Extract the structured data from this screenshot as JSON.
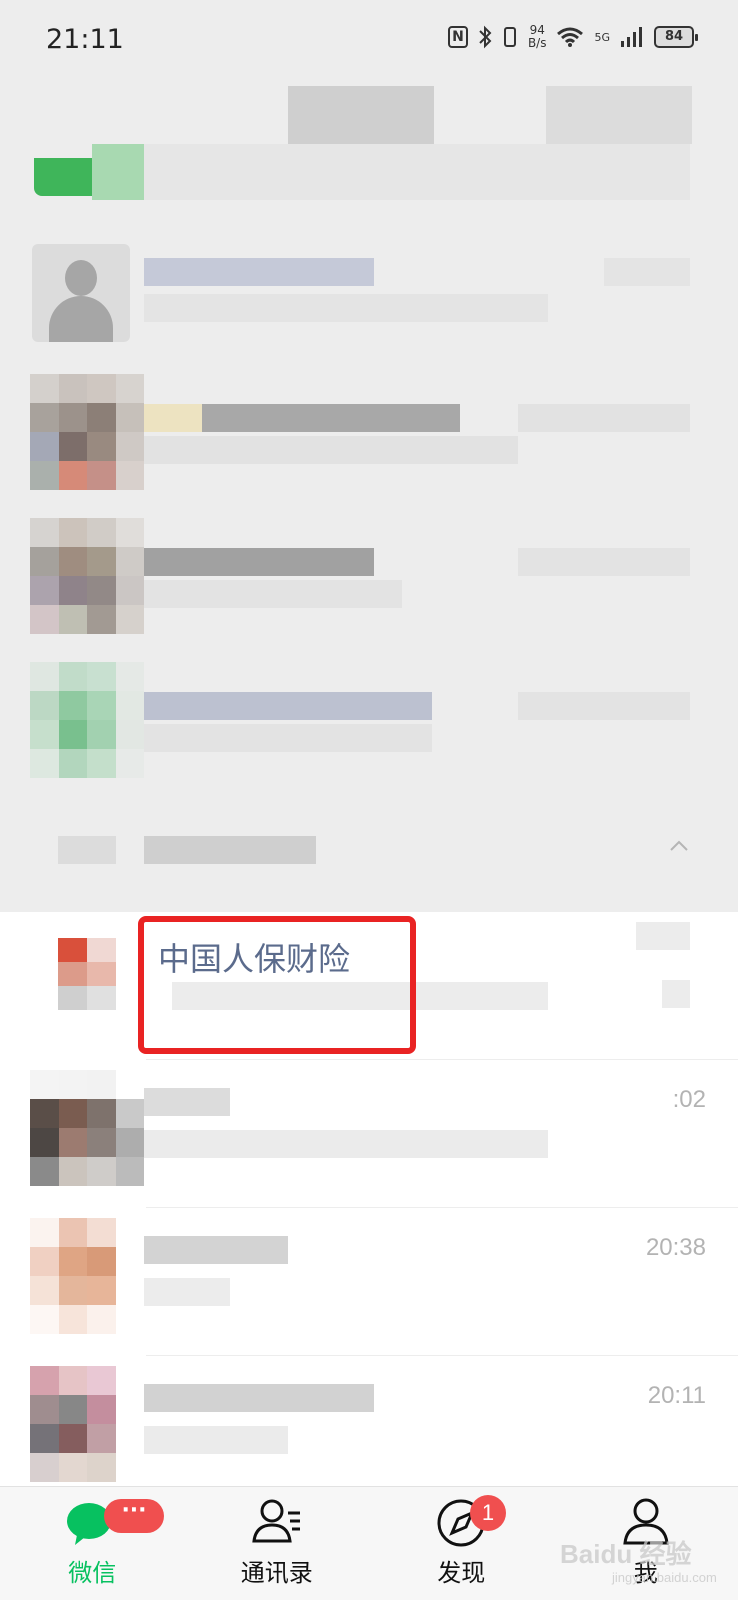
{
  "status_bar": {
    "time": "21:11",
    "net_speed_value": "94",
    "net_speed_unit": "B/s",
    "signal_label": "5G",
    "battery": "84"
  },
  "chats": [
    {
      "name": "中国人保财险",
      "time": ""
    },
    {
      "name": "",
      "time": ":02"
    },
    {
      "name": "",
      "time": "20:38"
    },
    {
      "name": "",
      "time": "20:11"
    }
  ],
  "tabs": [
    {
      "label": "微信",
      "badge": "···"
    },
    {
      "label": "通讯录"
    },
    {
      "label": "发现",
      "badge": "1"
    },
    {
      "label": "我"
    }
  ],
  "watermark": {
    "text": "Baidu 经验",
    "sub": "jingyan.baidu.com"
  },
  "colors": {
    "accent": "#07c160",
    "badge": "#f04f4f",
    "highlight": "#e92323",
    "name_link": "#5b6b8c"
  }
}
